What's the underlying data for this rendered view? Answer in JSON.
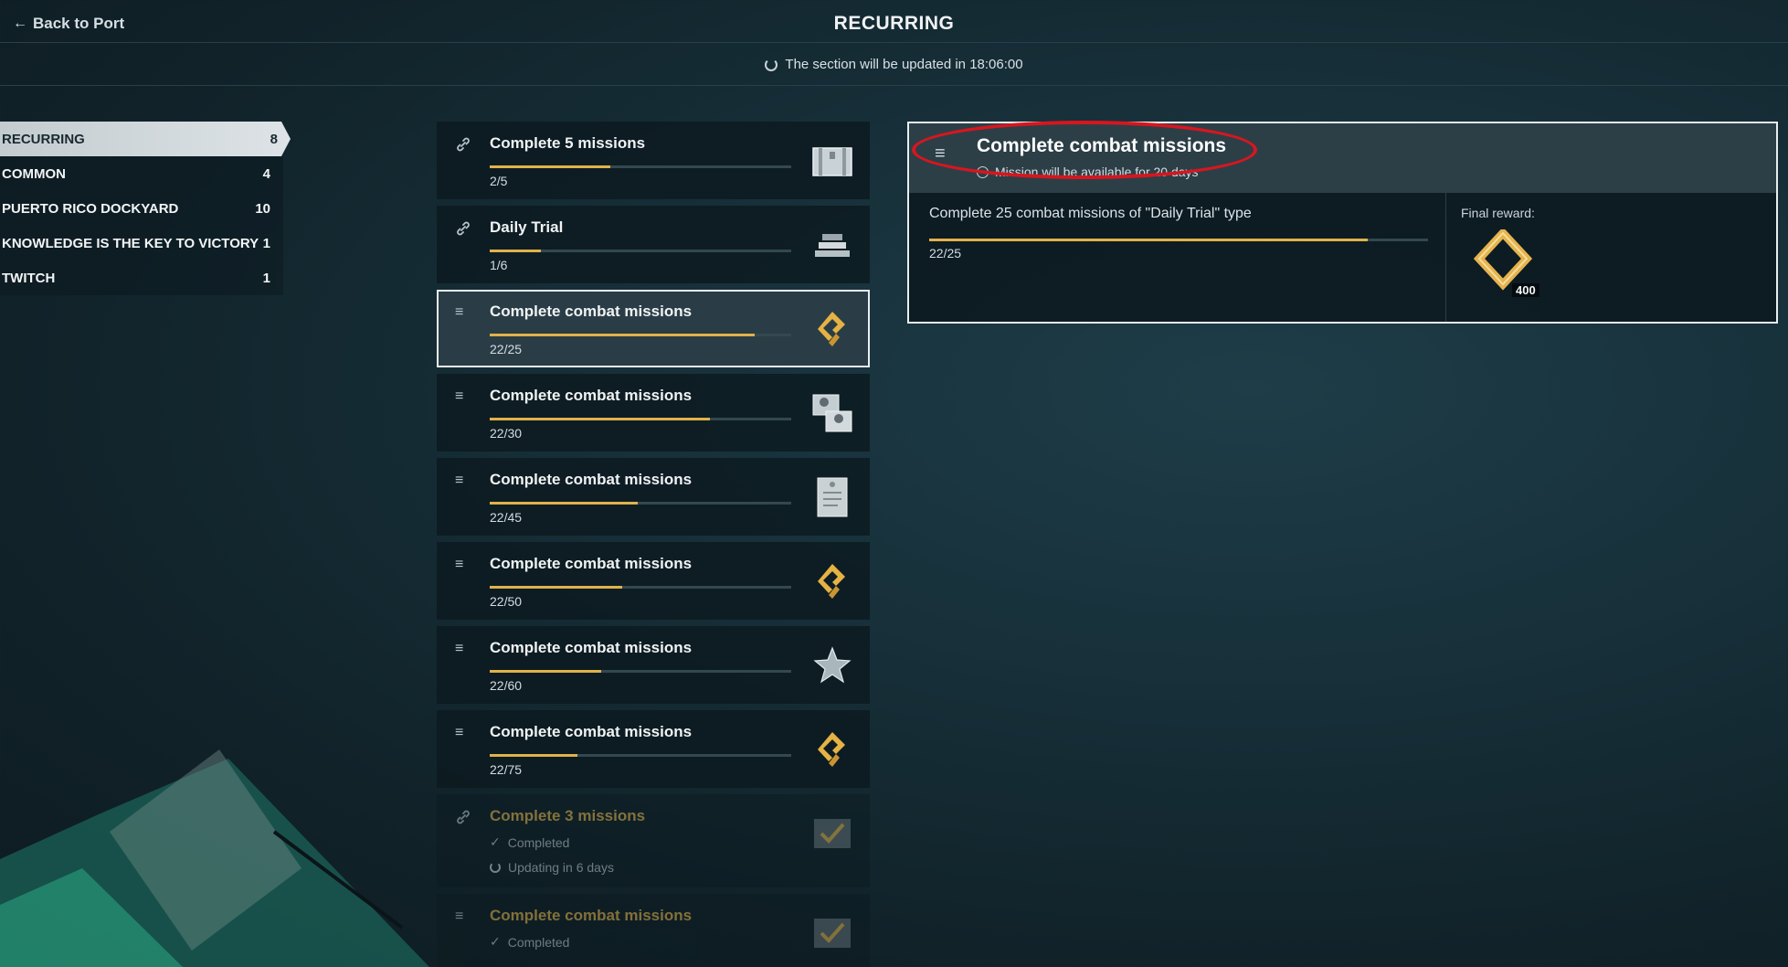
{
  "header": {
    "back_label": "Back to Port",
    "title": "RECURRING",
    "update_text": "The section will be updated in 18:06:00"
  },
  "sidebar": {
    "items": [
      {
        "label": "RECURRING",
        "count": "8"
      },
      {
        "label": "COMMON",
        "count": "4"
      },
      {
        "label": "PUERTO RICO DOCKYARD",
        "count": "10"
      },
      {
        "label": "KNOWLEDGE IS THE KEY TO VICTORY",
        "count": "1"
      },
      {
        "label": "TWITCH",
        "count": "1"
      }
    ]
  },
  "missions": [
    {
      "title": "Complete 5 missions",
      "count": "2/5",
      "progress": 0.4,
      "icon": "link-icon",
      "reward": "container-icon"
    },
    {
      "title": "Daily Trial",
      "count": "1/6",
      "progress": 0.17,
      "icon": "link-icon",
      "reward": "steel-icon"
    },
    {
      "title": "Complete combat missions",
      "count": "22/25",
      "progress": 0.88,
      "icon": "list-icon",
      "reward": "coal-icon"
    },
    {
      "title": "Complete combat missions",
      "count": "22/30",
      "progress": 0.73,
      "icon": "list-icon",
      "reward": "commander-icon"
    },
    {
      "title": "Complete combat missions",
      "count": "22/45",
      "progress": 0.49,
      "icon": "list-icon",
      "reward": "document-icon"
    },
    {
      "title": "Complete combat missions",
      "count": "22/50",
      "progress": 0.44,
      "icon": "list-icon",
      "reward": "coal-icon"
    },
    {
      "title": "Complete combat missions",
      "count": "22/60",
      "progress": 0.37,
      "icon": "list-icon",
      "reward": "star-icon"
    },
    {
      "title": "Complete combat missions",
      "count": "22/75",
      "progress": 0.29,
      "icon": "list-icon",
      "reward": "coal-icon"
    },
    {
      "title": "Complete 3 missions",
      "status": "Completed",
      "update": "Updating in 6 days",
      "icon": "link-icon",
      "reward": "checkmark-icon"
    },
    {
      "title": "Complete combat missions",
      "status": "Completed",
      "icon": "list-icon",
      "reward": "checkmark-icon"
    }
  ],
  "detail": {
    "title": "Complete combat missions",
    "availability": "Mission will be available for 20 days",
    "description": "Complete 25 combat missions of \"Daily Trial\" type",
    "count": "22/25",
    "progress": 0.88,
    "final_reward_label": "Final reward:",
    "final_reward_value": "400"
  },
  "colors": {
    "accent": "#e0b24a",
    "highlight_ring": "#d7161f"
  }
}
